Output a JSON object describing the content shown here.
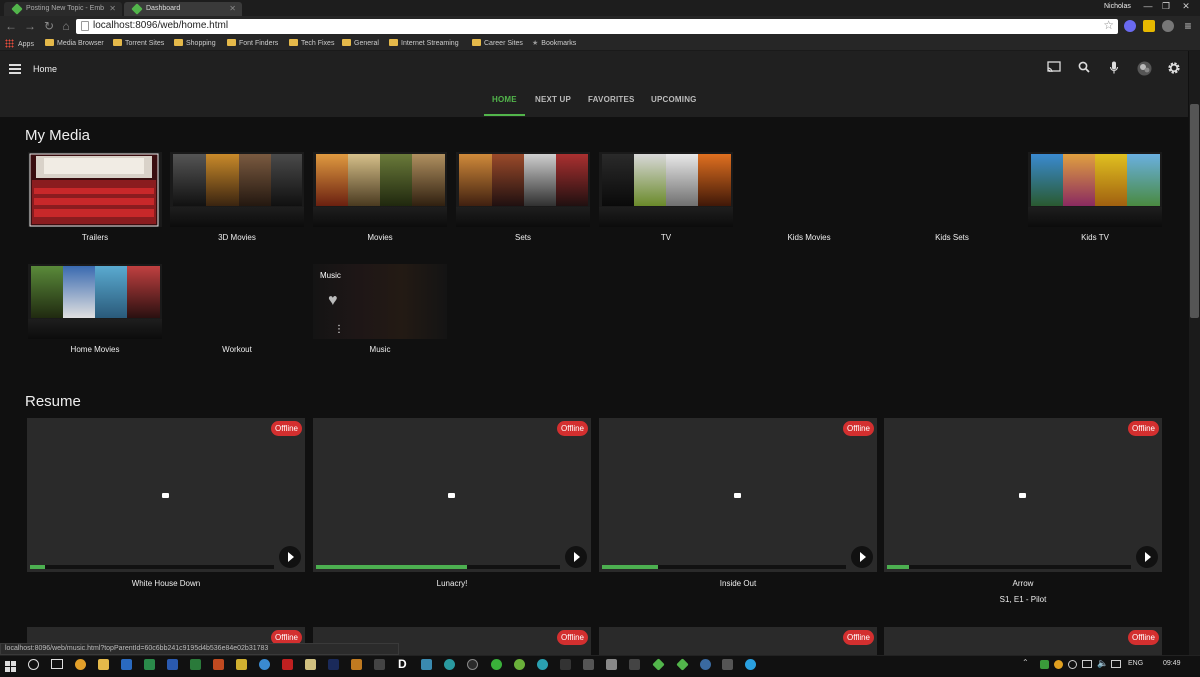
{
  "browser": {
    "tabs": [
      {
        "title": "Posting New Topic - Emb"
      },
      {
        "title": "Dashboard"
      }
    ],
    "profile_name": "Nicholas",
    "url": "localhost:8096/web/home.html",
    "bookmarks": [
      "Apps",
      "Media Browser",
      "Torrent Sites",
      "Shopping",
      "Font Finders",
      "Tech Fixes",
      "General",
      "Internet Streaming",
      "Career Sites",
      "Bookmarks"
    ]
  },
  "header": {
    "title": "Home"
  },
  "nav_tabs": [
    "HOME",
    "NEXT UP",
    "FAVORITES",
    "UPCOMING"
  ],
  "my_media": {
    "title": "My Media",
    "items": [
      {
        "label": "Trailers"
      },
      {
        "label": "3D Movies"
      },
      {
        "label": "Movies"
      },
      {
        "label": "Sets"
      },
      {
        "label": "TV"
      },
      {
        "label": "Kids Movies"
      },
      {
        "label": "Kids Sets"
      },
      {
        "label": "Kids TV"
      },
      {
        "label": "Home Movies"
      },
      {
        "label": "Workout"
      },
      {
        "label": "Music",
        "overlay_label": "Music"
      }
    ]
  },
  "resume": {
    "title": "Resume",
    "badge": "Offline",
    "items": [
      {
        "title": "White House Down",
        "subtitle": "",
        "progress": 0.06
      },
      {
        "title": "Lunacry!",
        "subtitle": "",
        "progress": 0.62
      },
      {
        "title": "Inside Out",
        "subtitle": "",
        "progress": 0.23
      },
      {
        "title": "Arrow",
        "subtitle": "S1, E1 - Pilot",
        "progress": 0.09
      }
    ]
  },
  "status_url": "localhost:8096/web/music.html?topParentId=60c6bb241c9195d4b536e84e02b31783",
  "taskbar": {
    "language": "ENG",
    "time": "09:49"
  },
  "colors": {
    "accent": "#52b54b",
    "offline_badge": "#d32f2f",
    "background": "#101010"
  }
}
